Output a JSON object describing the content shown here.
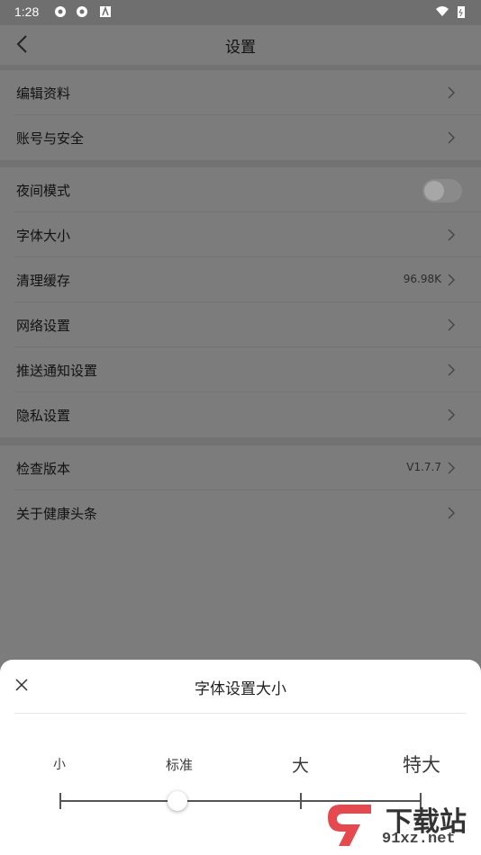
{
  "status": {
    "time": "1:28"
  },
  "header": {
    "title": "设置"
  },
  "group1": [
    {
      "label": "编辑资料"
    },
    {
      "label": "账号与安全"
    }
  ],
  "group2": {
    "night_mode": "夜间模式",
    "items": [
      {
        "label": "字体大小",
        "value": ""
      },
      {
        "label": "清理缓存",
        "value": "96.98K"
      },
      {
        "label": "网络设置",
        "value": ""
      },
      {
        "label": "推送通知设置",
        "value": ""
      },
      {
        "label": "隐私设置",
        "value": ""
      }
    ]
  },
  "group3": [
    {
      "label": "检查版本",
      "value": "V1.7.7"
    },
    {
      "label": "关于健康头条",
      "value": ""
    }
  ],
  "sheet": {
    "title": "字体设置大小",
    "options": [
      "小",
      "标准",
      "大",
      "特大"
    ],
    "selected": "标准"
  },
  "watermark": {
    "brand": "下载站",
    "site": "91xz.net"
  }
}
